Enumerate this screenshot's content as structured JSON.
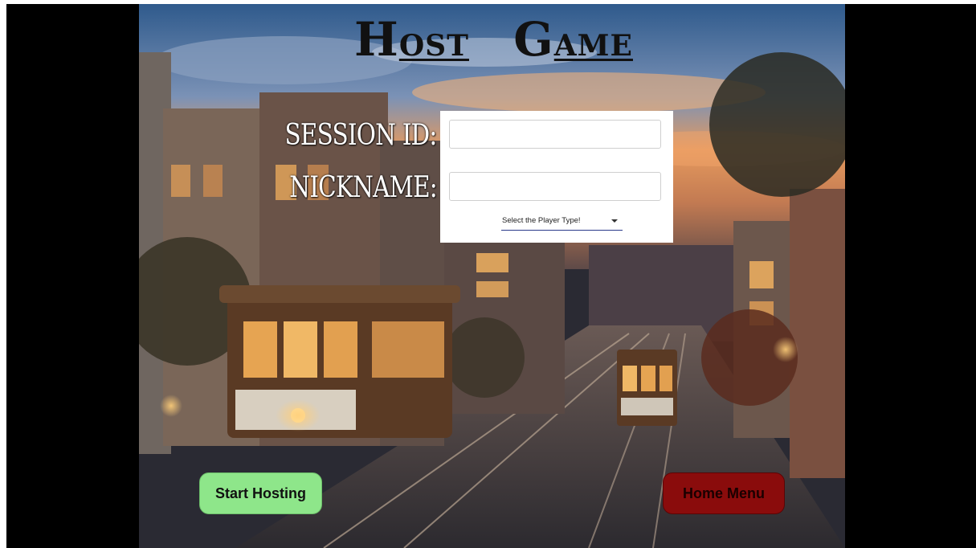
{
  "title": {
    "word1_first": "H",
    "word1_rest": "OST",
    "word2_first": "G",
    "word2_rest": "AME"
  },
  "form": {
    "session_label": "SESSION ID:",
    "nickname_label": "NICKNAME:",
    "session_value": "",
    "nickname_value": "",
    "player_type_label": "Select the Player Type!"
  },
  "buttons": {
    "start_label": "Start Hosting",
    "home_label": "Home Menu"
  },
  "colors": {
    "start_button": "#8ee68a",
    "home_button": "#8a0c0c",
    "panel": "#ffffff",
    "select_underline": "#2a3a8a"
  },
  "icons": {
    "player_select_caret": "caret-down-icon"
  }
}
